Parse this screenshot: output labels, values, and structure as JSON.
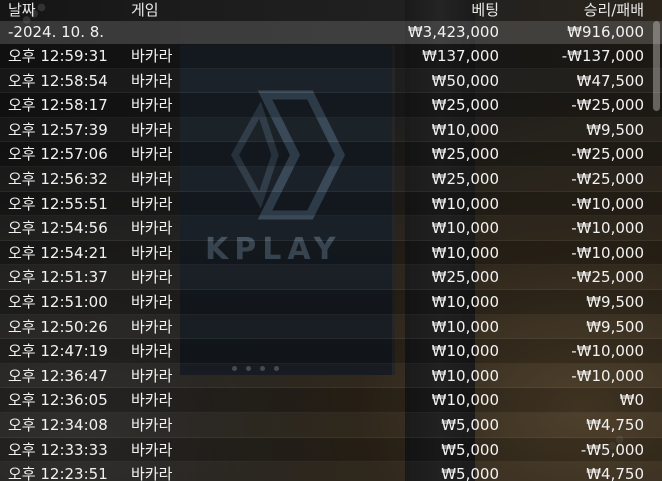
{
  "background": {
    "brand_text": "KPLAY"
  },
  "columns": {
    "date": "날짜",
    "game": "게임",
    "bet": "베팅",
    "result": "승리/패배"
  },
  "summary": {
    "date": "-2024. 10. 8.",
    "game": "",
    "bet": "₩3,423,000",
    "result": "₩916,000"
  },
  "rows": [
    {
      "time": "오후 12:59:31",
      "game": "바카라",
      "bet": "₩137,000",
      "result": "-₩137,000"
    },
    {
      "time": "오후 12:58:54",
      "game": "바카라",
      "bet": "₩50,000",
      "result": "₩47,500"
    },
    {
      "time": "오후 12:58:17",
      "game": "바카라",
      "bet": "₩25,000",
      "result": "-₩25,000"
    },
    {
      "time": "오후 12:57:39",
      "game": "바카라",
      "bet": "₩10,000",
      "result": "₩9,500"
    },
    {
      "time": "오후 12:57:06",
      "game": "바카라",
      "bet": "₩25,000",
      "result": "-₩25,000"
    },
    {
      "time": "오후 12:56:32",
      "game": "바카라",
      "bet": "₩25,000",
      "result": "-₩25,000"
    },
    {
      "time": "오후 12:55:51",
      "game": "바카라",
      "bet": "₩10,000",
      "result": "-₩10,000"
    },
    {
      "time": "오후 12:54:56",
      "game": "바카라",
      "bet": "₩10,000",
      "result": "-₩10,000"
    },
    {
      "time": "오후 12:54:21",
      "game": "바카라",
      "bet": "₩10,000",
      "result": "-₩10,000"
    },
    {
      "time": "오후 12:51:37",
      "game": "바카라",
      "bet": "₩25,000",
      "result": "-₩25,000"
    },
    {
      "time": "오후 12:51:00",
      "game": "바카라",
      "bet": "₩10,000",
      "result": "₩9,500"
    },
    {
      "time": "오후 12:50:26",
      "game": "바카라",
      "bet": "₩10,000",
      "result": "₩9,500"
    },
    {
      "time": "오후 12:47:19",
      "game": "바카라",
      "bet": "₩10,000",
      "result": "-₩10,000"
    },
    {
      "time": "오후 12:36:47",
      "game": "바카라",
      "bet": "₩10,000",
      "result": "-₩10,000"
    },
    {
      "time": "오후 12:36:05",
      "game": "바카라",
      "bet": "₩10,000",
      "result": "₩0"
    },
    {
      "time": "오후 12:34:08",
      "game": "바카라",
      "bet": "₩5,000",
      "result": "₩4,750"
    },
    {
      "time": "오후 12:33:33",
      "game": "바카라",
      "bet": "₩5,000",
      "result": "-₩5,000"
    },
    {
      "time": "오후 12:23:51",
      "game": "바카라",
      "bet": "₩5,000",
      "result": "₩4,750"
    }
  ]
}
